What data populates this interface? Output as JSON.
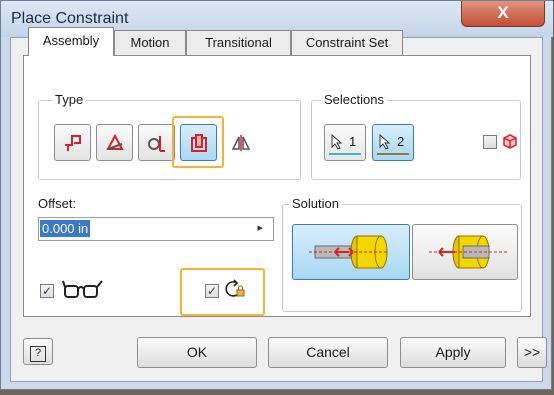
{
  "window": {
    "title": "Place Constraint",
    "close_glyph": "X"
  },
  "tabs": [
    {
      "label": "Assembly",
      "active": true
    },
    {
      "label": "Motion",
      "active": false
    },
    {
      "label": "Transitional",
      "active": false
    },
    {
      "label": "Constraint Set",
      "active": false
    }
  ],
  "type_group": {
    "label": "Type",
    "buttons": [
      {
        "icon": "mate-icon",
        "selected": false
      },
      {
        "icon": "angle-icon",
        "selected": false
      },
      {
        "icon": "tangent-icon",
        "selected": false
      },
      {
        "icon": "insert-icon",
        "selected": true
      },
      {
        "icon": "symmetry-icon",
        "selected": false
      }
    ]
  },
  "selections_group": {
    "label": "Selections",
    "select1_label": "1",
    "select2_label": "2",
    "first_selection_color": "#39b8c9",
    "second_selection_color": "#8c7a3a",
    "cb_checked": false
  },
  "offset": {
    "label": "Offset:",
    "value": "0.000 in",
    "arrow": "▸"
  },
  "preview_checkbox": {
    "checked": true,
    "check": "✓"
  },
  "predict_checkbox": {
    "checked": true,
    "check": "✓"
  },
  "solution_group": {
    "label": "Solution",
    "options": [
      "opposed",
      "aligned"
    ],
    "selected": "opposed"
  },
  "buttons": {
    "help": "?",
    "ok": "OK",
    "cancel": "Cancel",
    "apply": "Apply",
    "more": ">>"
  },
  "colors": {
    "accent": "#f0b43c",
    "selected": "#a9d7f3"
  }
}
